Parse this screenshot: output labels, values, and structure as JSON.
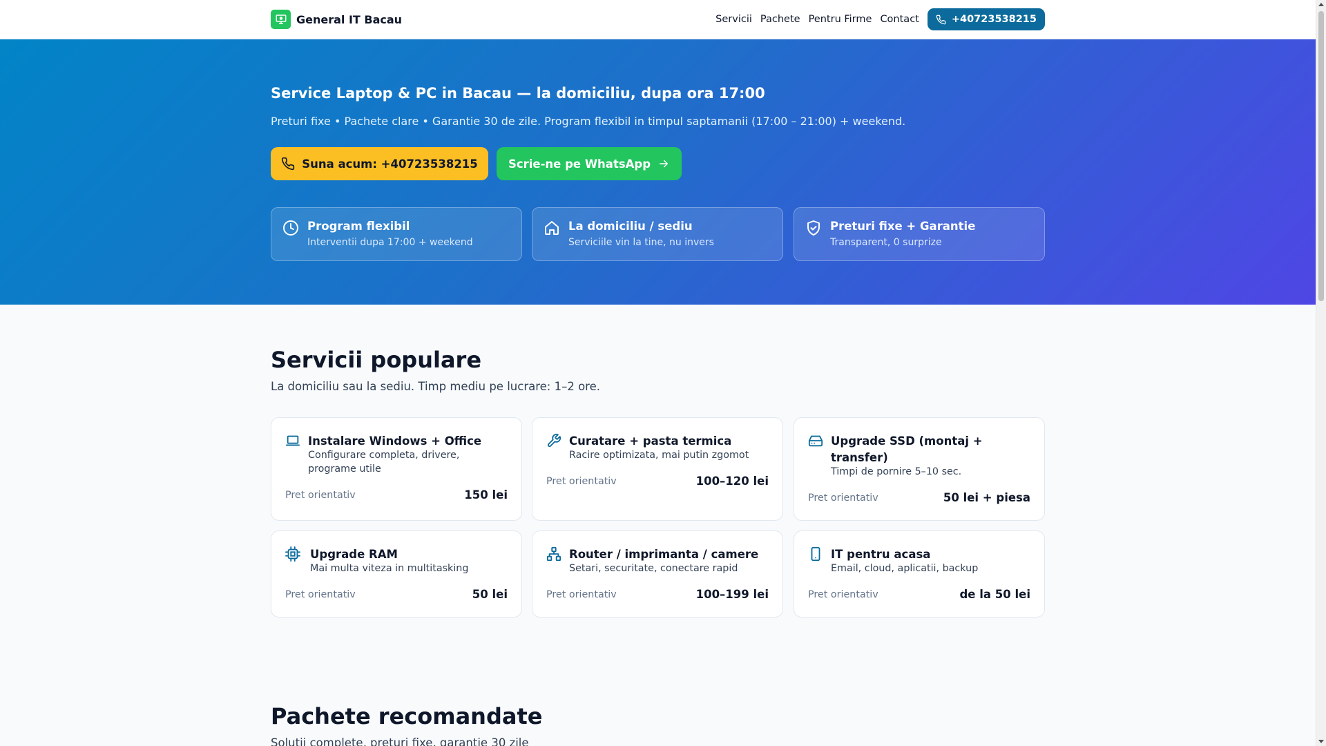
{
  "header": {
    "brand": "General IT Bacau",
    "nav": [
      "Servicii",
      "Pachete",
      "Pentru Firme",
      "Contact"
    ],
    "phone": "+40723538215"
  },
  "hero": {
    "title": "Service Laptop & PC in Bacau — la domiciliu, dupa ora 17:00",
    "subtitle": "Preturi fixe • Pachete clare • Garantie 30 de zile. Program flexibil in timpul saptamanii (17:00 – 21:00) + weekend.",
    "call_button": "Suna acum: +40723538215",
    "whatsapp_button": "Scrie-ne pe WhatsApp",
    "features": [
      {
        "title": "Program flexibil",
        "subtitle": "Interventii dupa 17:00 + weekend",
        "icon": "clock-icon"
      },
      {
        "title": "La domiciliu / sediu",
        "subtitle": "Serviciile vin la tine, nu invers",
        "icon": "home-icon"
      },
      {
        "title": "Preturi fixe + Garantie",
        "subtitle": "Transparent, 0 surprize",
        "icon": "shield-check-icon"
      }
    ]
  },
  "services": {
    "title": "Servicii populare",
    "subtitle": "La domiciliu sau la sediu. Timp mediu pe lucrare: 1–2 ore.",
    "price_label": "Pret orientativ",
    "items": [
      {
        "title": "Instalare Windows + Office",
        "desc": "Configurare completa, drivere, programe utile",
        "price": "150 lei",
        "icon": "laptop-icon"
      },
      {
        "title": "Curatare + pasta termica",
        "desc": "Racire optimizata, mai putin zgomot",
        "price": "100–120 lei",
        "icon": "wrench-icon"
      },
      {
        "title": "Upgrade SSD (montaj + transfer)",
        "desc": "Timpi de pornire 5–10 sec.",
        "price": "50 lei + piesa",
        "icon": "drive-icon"
      },
      {
        "title": "Upgrade RAM",
        "desc": "Mai multa viteza in multitasking",
        "price": "50 lei",
        "icon": "chip-icon"
      },
      {
        "title": "Router / imprimanta / camere",
        "desc": "Setari, securitate, conectare rapid",
        "price": "100–199 lei",
        "icon": "network-icon"
      },
      {
        "title": "IT pentru acasa",
        "desc": "Email, cloud, aplicatii, backup",
        "price": "de la 50 lei",
        "icon": "tablet-icon"
      }
    ]
  },
  "packages": {
    "title": "Pachete recomandate",
    "subtitle": "Solutii complete, preturi fixe, garantie 30 zile"
  },
  "colors": {
    "accent": "#0c6b9c",
    "call_button": "#fbbf24",
    "whatsapp": "#22c55e",
    "hero_start": "#0284c7",
    "hero_end": "#4f46e5"
  }
}
